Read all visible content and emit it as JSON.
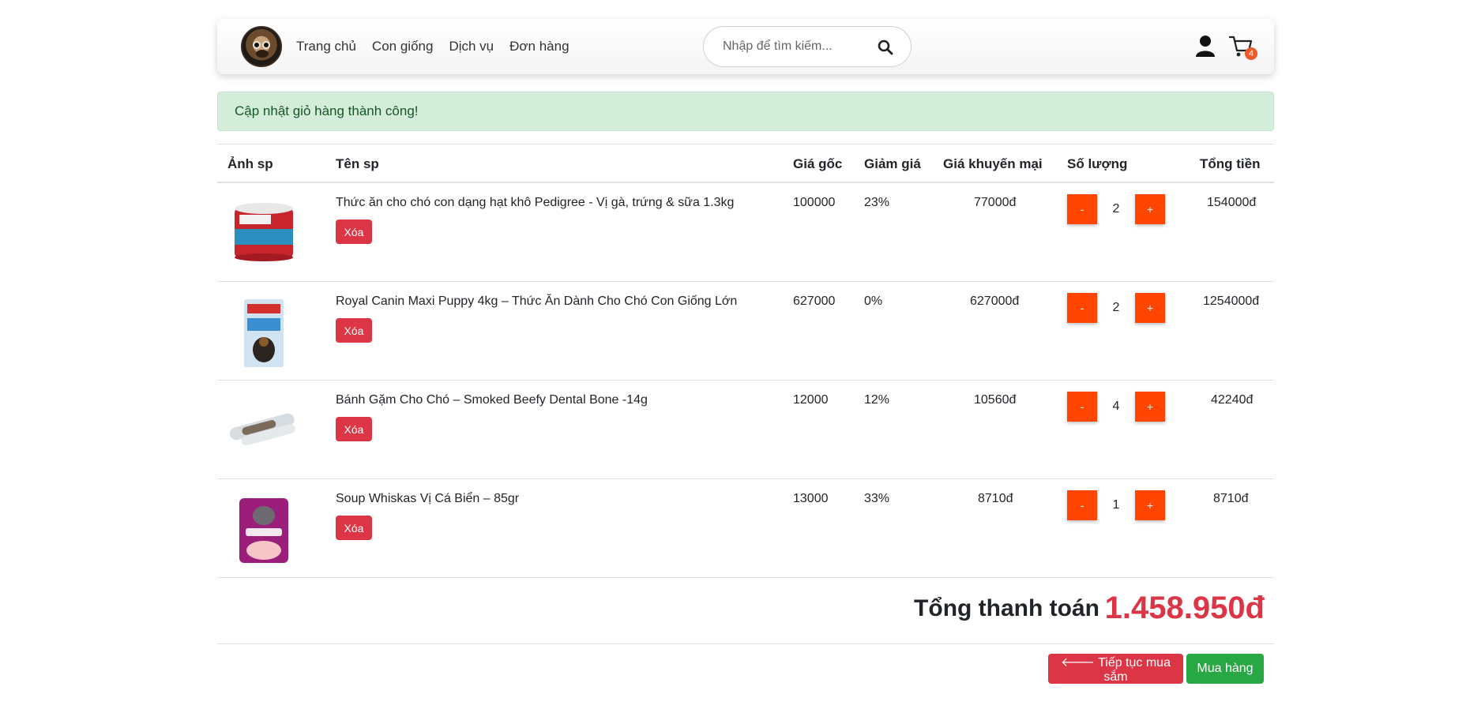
{
  "nav": {
    "links": [
      "Trang chủ",
      "Con giống",
      "Dịch vụ",
      "Đơn hàng"
    ],
    "search_placeholder": "Nhập để tìm kiếm...",
    "cart_count": "4"
  },
  "alert": {
    "message": "Cập nhật giỏ hàng thành công!"
  },
  "table": {
    "headers": [
      "Ảnh sp",
      "Tên sp",
      "Giá gốc",
      "Giảm giá",
      "Giá khuyến mại",
      "Số lượng",
      "Tổng tiền"
    ],
    "rows": [
      {
        "name": "Thức ăn cho chó con dạng hạt khô Pedigree - Vị gà, trứng & sữa 1.3kg",
        "price": "100000",
        "discount": "23%",
        "sale": "77000đ",
        "qty": "2",
        "total": "154000đ",
        "image": "pet-food-can"
      },
      {
        "name": "Royal Canin Maxi Puppy 4kg – Thức Ăn Dành Cho Chó Con Giống Lớn",
        "price": "627000",
        "discount": "0%",
        "sale": "627000đ",
        "qty": "2",
        "total": "1254000đ",
        "image": "royal-canin-bag"
      },
      {
        "name": "Bánh Gặm Cho Chó – Smoked Beefy Dental Bone -14g",
        "price": "12000",
        "discount": "12%",
        "sale": "10560đ",
        "qty": "4",
        "total": "42240đ",
        "image": "dental-bone"
      },
      {
        "name": "Soup Whiskas Vị Cá Biển – 85gr",
        "price": "13000",
        "discount": "33%",
        "sale": "8710đ",
        "qty": "1",
        "total": "8710đ",
        "image": "whiskas-pouch"
      }
    ],
    "delete_label": "Xóa",
    "minus_label": "-",
    "plus_label": "+"
  },
  "summary": {
    "total_label": "Tổng thanh toán",
    "total_value": "1.458.950đ"
  },
  "actions": {
    "continue_label": "Tiếp tục mua sắm",
    "buy_label": "Mua hàng"
  },
  "colors": {
    "accent": "#ff4500",
    "danger": "#dc3545",
    "success": "#28a745",
    "alert_bg": "#d4edda"
  }
}
